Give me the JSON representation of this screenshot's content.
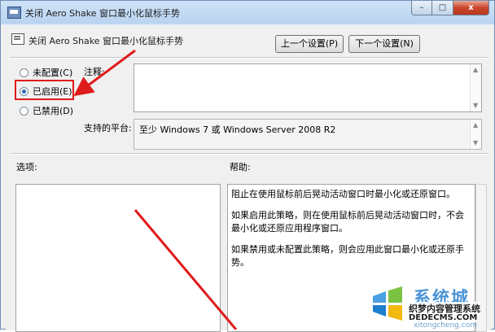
{
  "window": {
    "title": "关闭 Aero Shake 窗口最小化鼠标手势",
    "controls": {
      "minimize": "–",
      "maximize": "□",
      "close": "x"
    }
  },
  "header": {
    "title": "关闭 Aero Shake 窗口最小化鼠标手势",
    "prev_button": "上一个设置(P)",
    "next_button": "下一个设置(N)"
  },
  "state": {
    "options": [
      {
        "label": "未配置(C)",
        "checked": false
      },
      {
        "label": "已启用(E)",
        "checked": true
      },
      {
        "label": "已禁用(D)",
        "checked": false
      }
    ]
  },
  "comment": {
    "label": "注释:",
    "value": ""
  },
  "platform": {
    "label": "支持的平台:",
    "value": "至少 Windows 7 或 Windows Server 2008 R2"
  },
  "options_panel": {
    "label": "选项:"
  },
  "help_panel": {
    "label": "帮助:",
    "paragraphs": [
      "阻止在使用鼠标前后晃动活动窗口时最小化或还原窗口。",
      "如果启用此策略，则在使用鼠标前后晃动活动窗口时，不会最小化或还原应用程序窗口。",
      "如果禁用或未配置此策略，则会应用此窗口最小化或还原手势。"
    ]
  },
  "watermark": {
    "brand": "系统城",
    "cn": "织梦内容管理系统",
    "en": "DEDECMS.COM",
    "site": "xitongcheng.com"
  },
  "colors": {
    "annotation_red": "#e01b1b",
    "selected_radio": "#2a6ab8"
  }
}
